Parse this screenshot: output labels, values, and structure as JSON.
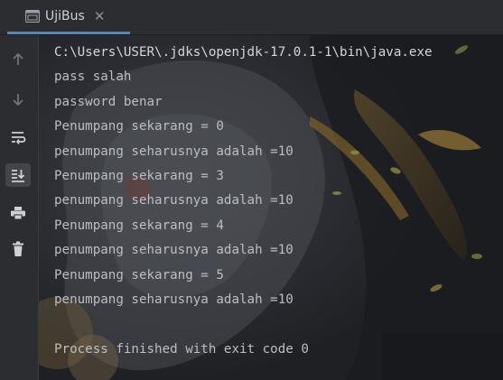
{
  "tab": {
    "title": "UjiBus",
    "close_symbol": "✕",
    "icon": "console-window-icon",
    "accent_color": "#4a88c7"
  },
  "toolbar": {
    "buttons": [
      {
        "name": "up-arrow-icon",
        "tooltip": ""
      },
      {
        "name": "down-arrow-icon",
        "tooltip": ""
      },
      {
        "name": "soft-wrap-icon",
        "tooltip": ""
      },
      {
        "name": "scroll-to-end-icon",
        "tooltip": "",
        "active": true
      },
      {
        "name": "print-icon",
        "tooltip": ""
      },
      {
        "name": "trash-icon",
        "tooltip": ""
      }
    ]
  },
  "console": {
    "lines": [
      "C:\\Users\\USER\\.jdks\\openjdk-17.0.1-1\\bin\\java.exe",
      "pass salah",
      "password benar",
      "Penumpang sekarang = 0",
      "penumpang seharusnya adalah =10",
      "Penumpang sekarang = 3",
      "penumpang seharusnya adalah =10",
      "Penumpang sekarang = 4",
      "penumpang seharusnya adalah =10",
      "Penumpang sekarang = 5",
      "penumpang seharusnya adalah =10",
      "",
      "Process finished with exit code 0"
    ]
  }
}
